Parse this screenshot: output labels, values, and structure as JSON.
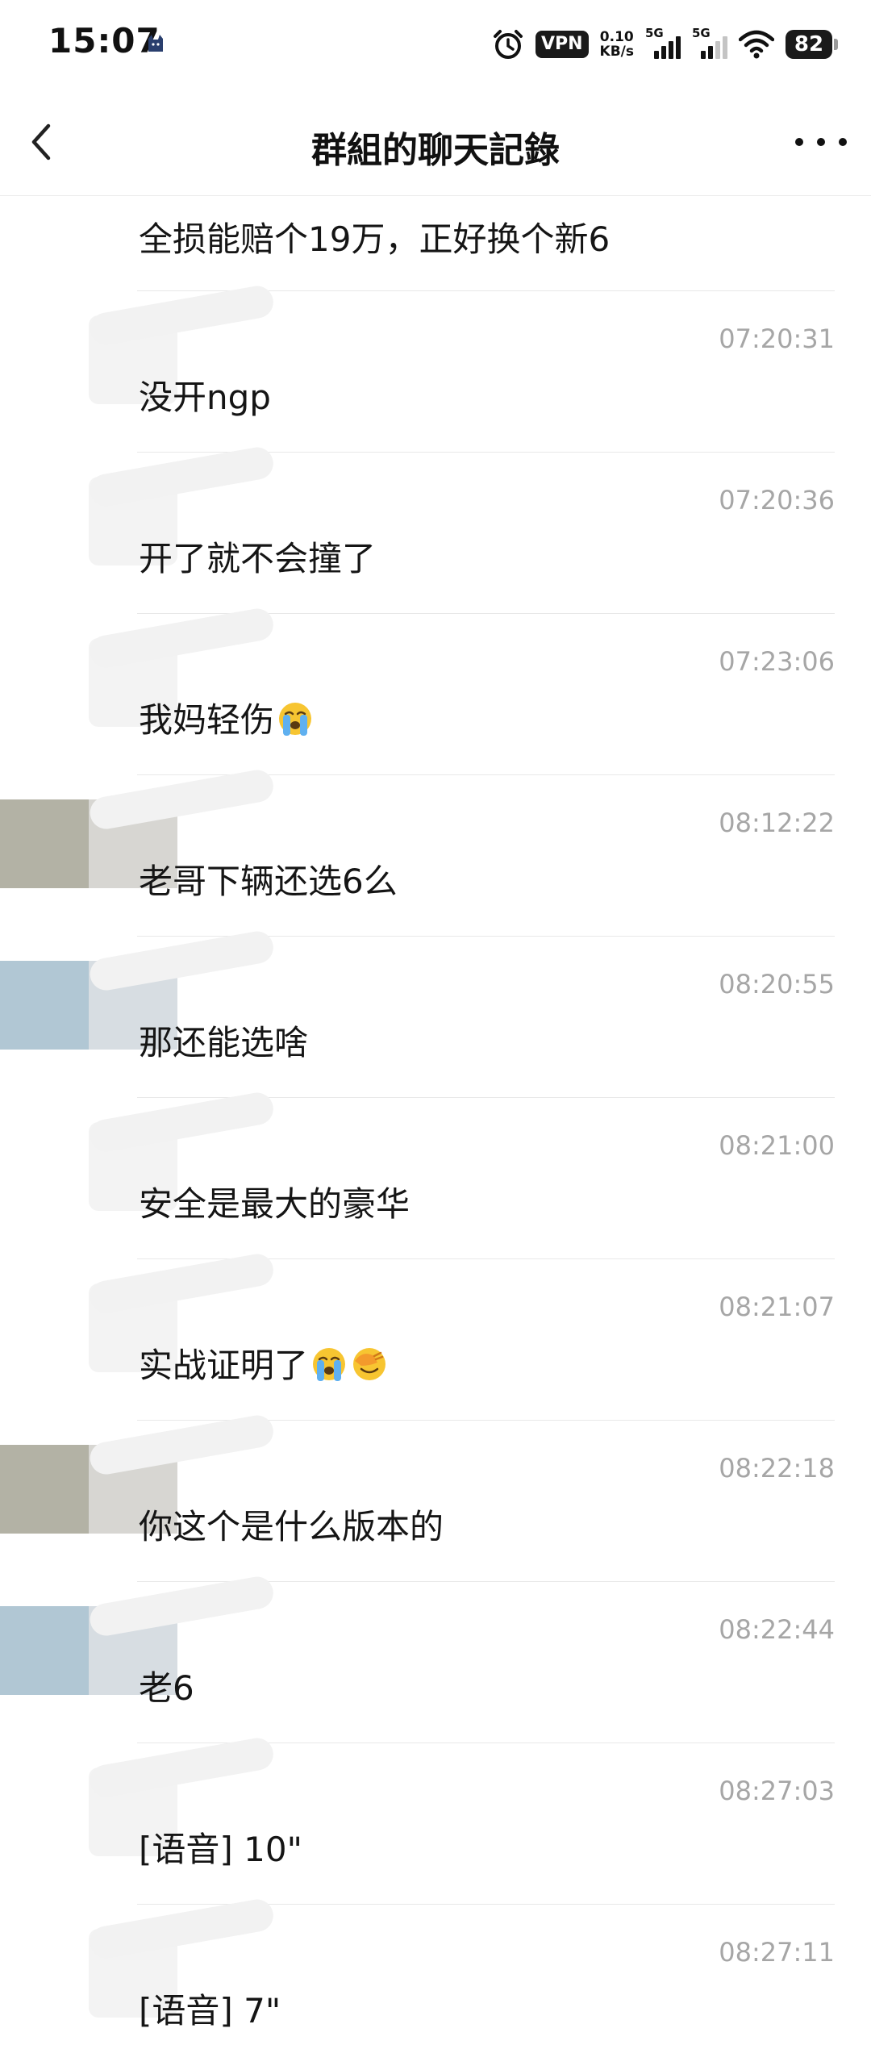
{
  "status_bar": {
    "time": "15:07",
    "vpn": "VPN",
    "speed_value": "0.10",
    "speed_unit": "KB/s",
    "sim1_label": "5G",
    "sim2_label": "5G",
    "battery": "82"
  },
  "header": {
    "title": "群組的聊天記錄"
  },
  "messages": [
    {
      "time": "",
      "text": "全损能赔个19万，正好换个新6",
      "emojis": []
    },
    {
      "time": "07:20:31",
      "text": "没开ngp",
      "emojis": []
    },
    {
      "time": "07:20:36",
      "text": "开了就不会撞了",
      "emojis": []
    },
    {
      "time": "07:23:06",
      "text": "我妈轻伤",
      "emojis": [
        "loudly-crying-face"
      ]
    },
    {
      "time": "08:12:22",
      "text": "老哥下辆还选6么",
      "emojis": []
    },
    {
      "time": "08:20:55",
      "text": "那还能选啥",
      "emojis": []
    },
    {
      "time": "08:21:00",
      "text": "安全是最大的豪华",
      "emojis": []
    },
    {
      "time": "08:21:07",
      "text": "实战证明了",
      "emojis": [
        "loudly-crying-face",
        "face-palm"
      ]
    },
    {
      "time": "08:22:18",
      "text": "你这个是什么版本的",
      "emojis": []
    },
    {
      "time": "08:22:44",
      "text": "老6",
      "emojis": []
    },
    {
      "time": "08:27:03",
      "text": "[语音] 10\"",
      "emojis": []
    },
    {
      "time": "08:27:11",
      "text": "[语音] 7\"",
      "emojis": []
    }
  ],
  "colors": {
    "timestamp": "#a6a6a6",
    "divider": "#e8e8e8",
    "text": "#151515"
  }
}
